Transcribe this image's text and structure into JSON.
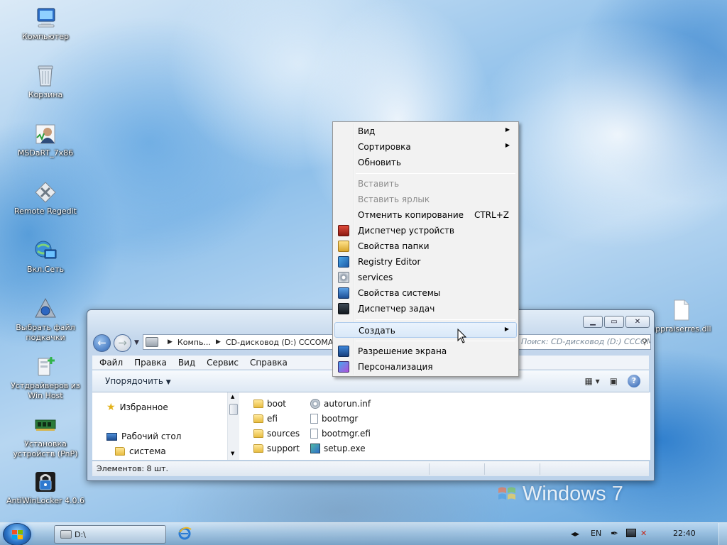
{
  "desktop": {
    "icons": [
      {
        "label": "Компьютер"
      },
      {
        "label": "Корзина"
      },
      {
        "label": "MSDaRT_7x86"
      },
      {
        "label": "Remote Regedit"
      },
      {
        "label": "Вкл.Сеть"
      },
      {
        "label": "Выбрать файл подкачки"
      },
      {
        "label": "Устдрайверов из Win Host"
      },
      {
        "label": "Установка устройств (PnP)"
      },
      {
        "label": "AntiWinLocker 4.0.6"
      },
      {
        "label": "appraiserres.dll"
      }
    ],
    "watermark": "Windows 7"
  },
  "context_menu": {
    "items": [
      {
        "label": "Вид",
        "submenu": true
      },
      {
        "label": "Сортировка",
        "submenu": true
      },
      {
        "label": "Обновить"
      },
      {
        "label": "Вставить",
        "disabled": true
      },
      {
        "label": "Вставить ярлык",
        "disabled": true
      },
      {
        "label": "Отменить копирование",
        "shortcut": "CTRL+Z"
      },
      {
        "label": "Диспетчер устройств",
        "icon": "device-manager-icon"
      },
      {
        "label": "Свойства папки",
        "icon": "folder-options-icon"
      },
      {
        "label": "Registry Editor",
        "icon": "registry-editor-icon"
      },
      {
        "label": "services",
        "icon": "services-icon"
      },
      {
        "label": "Свойства системы",
        "icon": "system-properties-icon"
      },
      {
        "label": "Диспетчер задач",
        "icon": "task-manager-icon"
      },
      {
        "label": "Создать",
        "submenu": true,
        "highlighted": true
      },
      {
        "label": "Разрешение экрана",
        "icon": "screen-resolution-icon"
      },
      {
        "label": "Персонализация",
        "icon": "personalization-icon"
      }
    ]
  },
  "explorer": {
    "address": {
      "part1": "Компь...",
      "part2": "CD-дисковод (D:) CCCOMA_X..."
    },
    "search_placeholder": "Поиск: CD-дисковод (D:) CCCOMA_X...",
    "menu": [
      "Файл",
      "Правка",
      "Вид",
      "Сервис",
      "Справка"
    ],
    "organize_label": "Упорядочить",
    "nav": [
      {
        "label": "Избранное",
        "icon": "star-icon"
      },
      {
        "label": "Рабочий стол",
        "icon": "desktop-icon"
      },
      {
        "label": "система",
        "icon": "folder-icon"
      }
    ],
    "files": [
      {
        "name": "boot",
        "type": "folder"
      },
      {
        "name": "efi",
        "type": "folder"
      },
      {
        "name": "sources",
        "type": "folder"
      },
      {
        "name": "support",
        "type": "folder"
      },
      {
        "name": "autorun.inf",
        "type": "settings"
      },
      {
        "name": "bootmgr",
        "type": "file"
      },
      {
        "name": "bootmgr.efi",
        "type": "file"
      },
      {
        "name": "setup.exe",
        "type": "exe"
      }
    ],
    "status": "Элементов: 8 шт."
  },
  "taskbar": {
    "task_label": "D:\\",
    "language": "EN",
    "clock": "22:40"
  }
}
